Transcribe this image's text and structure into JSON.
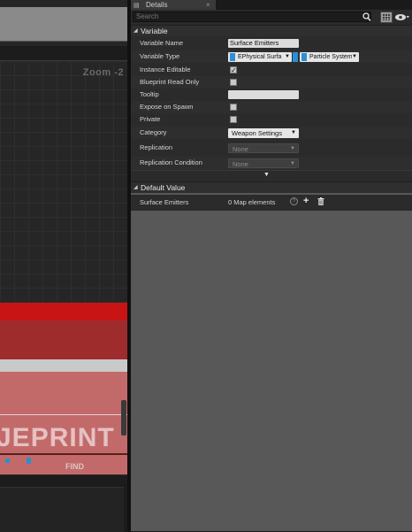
{
  "graph": {
    "zoom_label": "Zoom -2",
    "watermark": "JEPRINT",
    "find_label": "FIND"
  },
  "details": {
    "tab_label": "Details",
    "tab_close": "×",
    "search_placeholder": "Search",
    "sections": {
      "variable": "Variable",
      "default_value": "Default Value"
    },
    "rows": [
      {
        "label": "Variable Name",
        "value": "Surface Emitters"
      },
      {
        "label": "Variable Type",
        "key_type": "EPhysical Surfa",
        "value_type": "Particle System"
      },
      {
        "label": "Instance Editable",
        "checked": true,
        "check_glyph": "✓"
      },
      {
        "label": "Blueprint Read Only",
        "checked": false
      },
      {
        "label": "Tooltip",
        "value": ""
      },
      {
        "label": "Expose on Spawn",
        "checked": false
      },
      {
        "label": "Private",
        "checked": false
      },
      {
        "label": "Category",
        "value": "Weapon Settings"
      },
      {
        "label": "Replication",
        "value": "None"
      },
      {
        "label": "Replication Condition",
        "value": "None"
      }
    ],
    "default_value": {
      "label": "Surface Emitters",
      "value": "0 Map elements",
      "help_glyph": "?",
      "add_glyph": "+"
    }
  },
  "colors": {
    "accent_blue": "#2a8fd6",
    "red_band": "#c81414"
  }
}
